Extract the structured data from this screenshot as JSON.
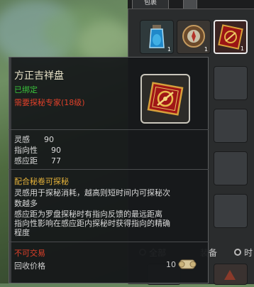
{
  "tabs": {
    "bag": "包裹",
    "second": ""
  },
  "inventory": {
    "counts": [
      "1",
      "1",
      "1"
    ],
    "filter_all": "全部",
    "filter_equip": "装备",
    "filter_time": "时"
  },
  "tooltip": {
    "item_name": "方正吉祥盘",
    "bound": "已绑定",
    "requirement": "需要探秘专家(18级)",
    "stats": [
      {
        "label": "灵感",
        "value": "90"
      },
      {
        "label": "指向性",
        "value": "90"
      },
      {
        "label": "感应距",
        "value": "77"
      }
    ],
    "scroll_title": "配合秘卷可探秘",
    "desc_lines": [
      "灵感用于探秘消耗，越高则短时间内可探秘次",
      "数越多",
      "感应距为罗盘探秘时有指向反馈的最远距离",
      "指向性影响在感应距内探秘时获得指向的精确",
      "程度"
    ],
    "not_tradeable": "不可交易",
    "price_label": "回收价格",
    "price_value": "10"
  },
  "colors": {
    "bound": "#39c23b",
    "requirement": "#e0402a",
    "scroll_title": "#e5b23a",
    "not_tradeable": "#e0402a"
  }
}
